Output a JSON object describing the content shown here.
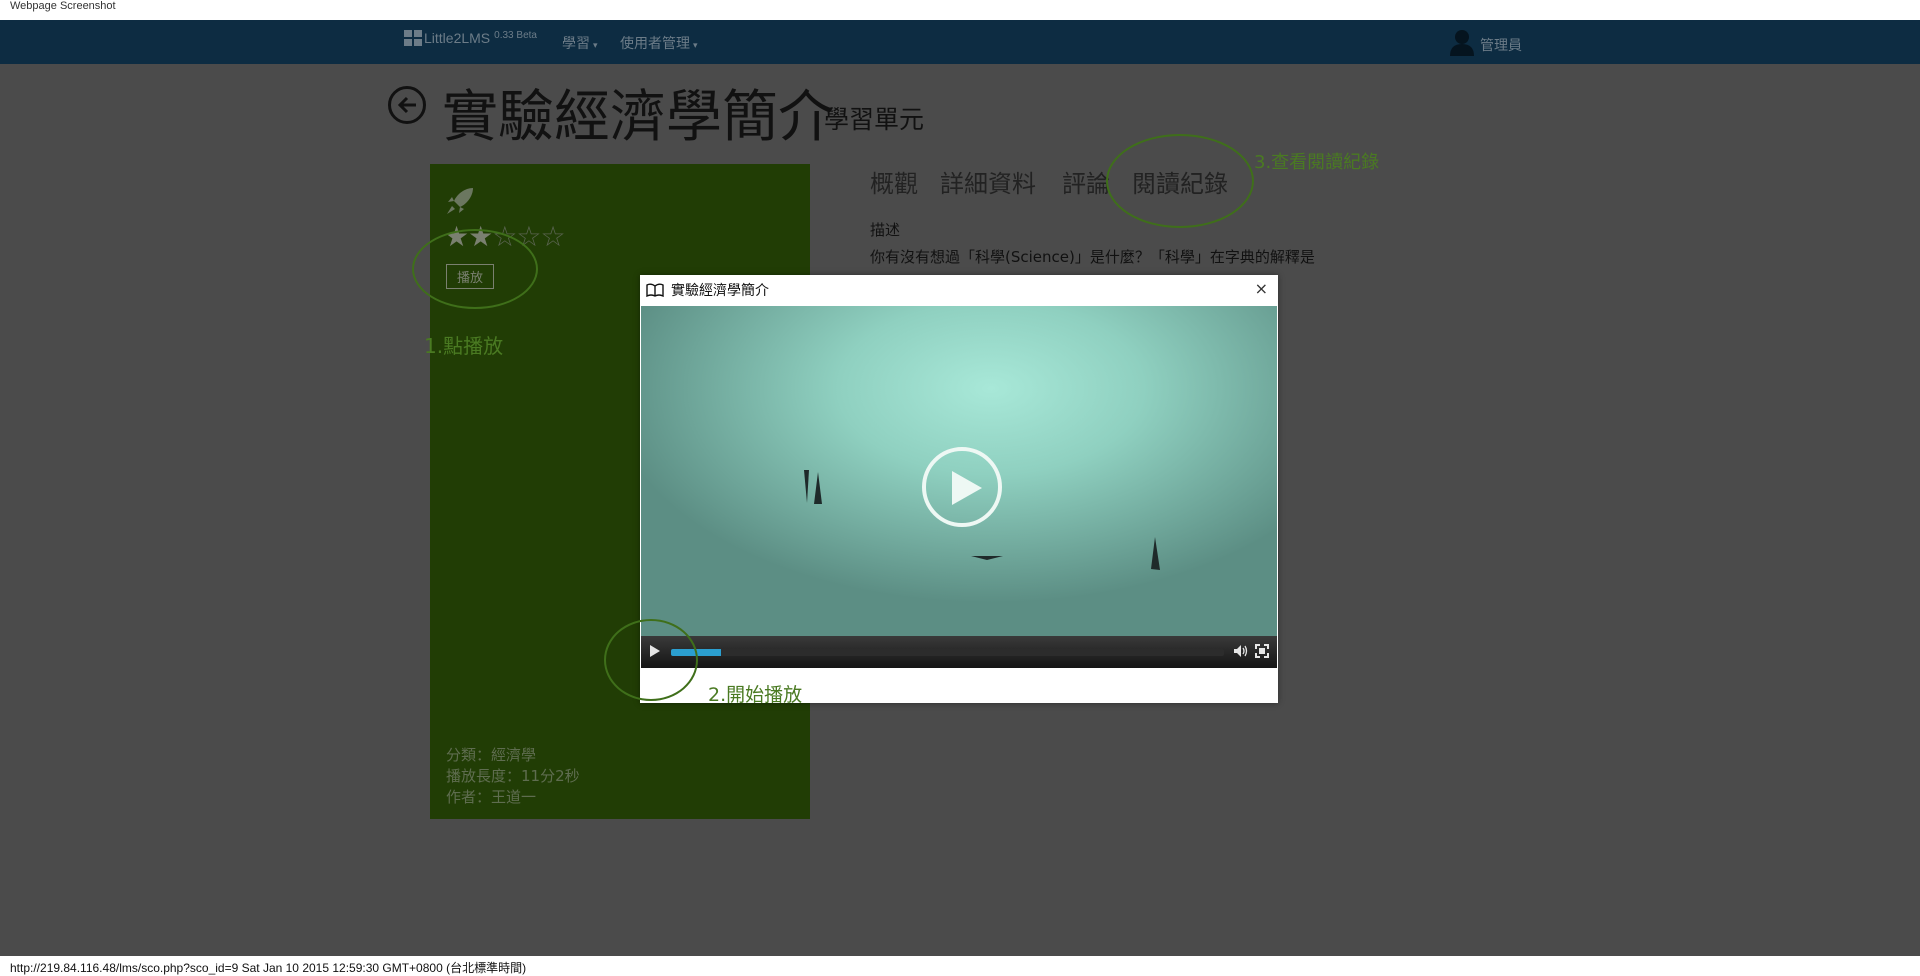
{
  "page_caption": "Webpage Screenshot",
  "navbar": {
    "brand": "Little2LMS",
    "version": "0.33 Beta",
    "menu": [
      {
        "label": "學習"
      },
      {
        "label": "使用者管理"
      }
    ],
    "user": "管理員"
  },
  "header": {
    "title": "實驗經濟學簡介",
    "subtitle": "學習單元"
  },
  "tile": {
    "rating": 2,
    "rating_max": 5,
    "play_label": "播放",
    "category": "分類：經濟學",
    "duration": "播放長度：11分2秒",
    "author": "作者：王道一"
  },
  "tabs": [
    "概觀",
    "詳細資料",
    "評論",
    "閱讀紀錄"
  ],
  "description": {
    "label": "描述",
    "text": "你有沒有想過「科學(Science)」是什麼？「科學」在字典的解釋是"
  },
  "dialog": {
    "title": "實驗經濟學簡介",
    "close": "×",
    "progress": 0.09
  },
  "annotations": {
    "click_play": "1.點播放",
    "start_play": "2.開始播放",
    "view_records": "3.查看閱讀紀錄"
  },
  "status_bar": "http://219.84.116.48/lms/sco.php?sco_id=9 Sat Jan 10 2015 12:59:30 GMT+0800 (台北標準時間)",
  "colors": {
    "navbar": "#0d2c42",
    "overlay": "#4b4b4b",
    "tile": "#213d05",
    "annotation": "#4a7a22",
    "progress": "#2b9fd0"
  }
}
